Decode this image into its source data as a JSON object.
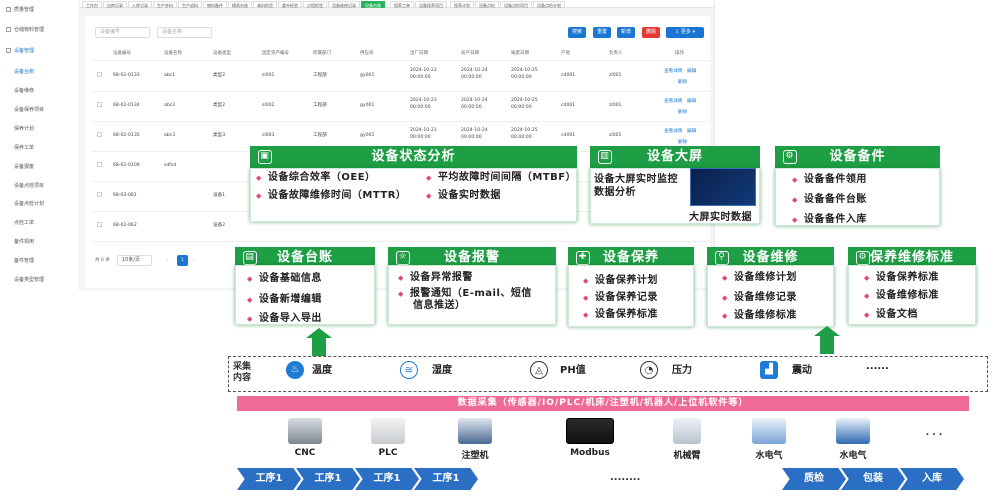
{
  "sidebar": {
    "items": [
      {
        "label": "质量管理",
        "active": false
      },
      {
        "label": "仓储物料管理",
        "active": false
      },
      {
        "label": "设备管理",
        "active": false
      },
      {
        "label": "设备台账",
        "active": true
      },
      {
        "label": "设备维修",
        "active": false
      },
      {
        "label": "设备保养项目",
        "active": false
      },
      {
        "label": "保养计划",
        "active": false
      },
      {
        "label": "保养工单",
        "active": false
      },
      {
        "label": "设备报废",
        "active": false
      },
      {
        "label": "设备点检项目",
        "active": false
      },
      {
        "label": "设备点检计划",
        "active": false
      },
      {
        "label": "点检工单",
        "active": false
      },
      {
        "label": "备件领用",
        "active": false
      },
      {
        "label": "备件管理",
        "active": false
      },
      {
        "label": "设备类型管理",
        "active": false
      }
    ]
  },
  "tabs": [
    "工作台",
    "出库记录",
    "入库记录",
    "生产补料",
    "生产退料",
    "物料备件",
    "模具台账",
    "来料检验",
    "委外检验",
    "过程检验",
    "设备维修记录",
    "设备台账",
    "保养工单",
    "设备保养项目",
    "保养计划",
    "设备点检",
    "设备点检项目",
    "设备点检计划"
  ],
  "active_tab_index": 11,
  "search": {
    "code_placeholder": "设备编号",
    "name_placeholder": "设备名称"
  },
  "toolbar": {
    "search": "搜索",
    "reset": "重置",
    "add": "新增",
    "delete": "删除",
    "more": "更多"
  },
  "table": {
    "headers": [
      "设备编号",
      "设备名称",
      "设备类型",
      "固定资产编号",
      "所属部门",
      "供应商",
      "出厂日期",
      "投产日期",
      "报废日期",
      "产地",
      "负责人",
      "操作"
    ],
    "rows": [
      {
        "code": "68-02-0133",
        "name": "abc1",
        "type": "类型2",
        "asset": "sl001",
        "dept": "工程部",
        "supplier": "gy001",
        "mfg": "2024-10-23 00:00:00",
        "prod": "2024-10-24 00:00:00",
        "scrap": "2024-10-25 00:00:00",
        "origin": "cd001",
        "owner": "zl001",
        "ops": [
          "查看详情",
          "编辑",
          "删除"
        ]
      },
      {
        "code": "68-02-0134",
        "name": "abc2",
        "type": "类型2",
        "asset": "sl002",
        "dept": "工程部",
        "supplier": "gy001",
        "mfg": "2024-10-23 00:00:00",
        "prod": "2024-10-24 00:00:00",
        "scrap": "2024-10-25 00:00:00",
        "origin": "cd001",
        "owner": "zl001",
        "ops": [
          "查看详情",
          "编辑",
          "删除"
        ]
      },
      {
        "code": "68-02-0135",
        "name": "abc3",
        "type": "类型3",
        "asset": "sl003",
        "dept": "工程部",
        "supplier": "gy001",
        "mfg": "2024-10-23 00:00:00",
        "prod": "2024-10-24 00:00:00",
        "scrap": "2024-10-25 00:00:00",
        "origin": "cd001",
        "owner": "zl001",
        "ops": [
          "查看详情",
          "编辑",
          "删除"
        ]
      },
      {
        "code": "68-02-0109",
        "name": "sdfsd",
        "type": "",
        "asset": "",
        "dept": "",
        "supplier": "",
        "mfg": "",
        "prod": "",
        "scrap": "",
        "origin": "",
        "owner": "",
        "ops": []
      },
      {
        "code": "68-03-061",
        "name": "",
        "type": "设备1",
        "asset": "",
        "dept": "",
        "supplier": "",
        "mfg": "",
        "prod": "",
        "scrap": "",
        "origin": "",
        "owner": "",
        "ops": []
      },
      {
        "code": "68-02-062",
        "name": "",
        "type": "设备2",
        "asset": "",
        "dept": "",
        "supplier": "",
        "mfg": "",
        "prod": "",
        "scrap": "",
        "origin": "",
        "owner": "",
        "ops": []
      }
    ]
  },
  "pager": {
    "total": "共 6 条",
    "size": "10条/页",
    "page": "1"
  },
  "diagram": {
    "analysis": {
      "title": "设备状态分析",
      "items": [
        "设备综合效率（OEE）",
        "平均故障时间间隔（MTBF）",
        "设备故障维修时间（MTTR）",
        "设备实时数据"
      ]
    },
    "screen": {
      "title": "设备大屏",
      "text1": "设备大屏实时监控",
      "text2": "数据分析",
      "text3": "大屏实时数据"
    },
    "spare": {
      "title": "设备备件",
      "items": [
        "设备备件领用",
        "设备备件台账",
        "设备备件入库"
      ]
    },
    "ledger": {
      "title": "设备台账",
      "items": [
        "设备基础信息",
        "设备新增编辑",
        "设备导入导出"
      ]
    },
    "alarm": {
      "title": "设备报警",
      "items": [
        "设备异常报警",
        "报警通知（E-mail、短信",
        "信息推送）"
      ]
    },
    "maint": {
      "title": "设备保养",
      "items": [
        "设备保养计划",
        "设备保养记录",
        "设备保养标准"
      ]
    },
    "repair": {
      "title": "设备维修",
      "items": [
        "设备维修计划",
        "设备维修记录",
        "设备维修标准"
      ]
    },
    "standard": {
      "title": "保养维修标准",
      "items": [
        "设备保养标准",
        "设备维修标准",
        "设备文档"
      ]
    },
    "collect": {
      "label1": "采集",
      "label2": "内容",
      "sensors": [
        "温度",
        "湿度",
        "PH值",
        "压力",
        "震动"
      ],
      "dots": "......",
      "bar": "数据采集（传感器/IO/PLC/机床/注塑机/机器人/上位机软件等）"
    },
    "devices": [
      "CNC",
      "PLC",
      "注塑机",
      "Modbus",
      "机械臂",
      "水电气",
      "水电气"
    ],
    "dev_dots": ". . .",
    "chain": [
      "工序1",
      "工序1",
      "工序1",
      "工序1",
      "质检",
      "包装",
      "入库"
    ],
    "chain_dots": "........"
  },
  "colors": {
    "green": "#1e9e45",
    "blue": "#2b6fc4",
    "pink": "#f06a96",
    "link": "#1976d2"
  }
}
